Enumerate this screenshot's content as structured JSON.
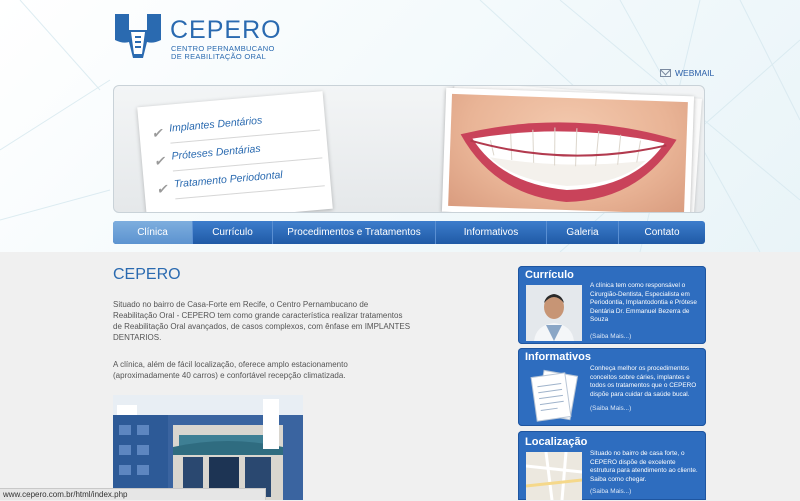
{
  "logo": {
    "name": "CEPERO",
    "subtitle_line1": "CENTRO PERNAMBUCANO",
    "subtitle_line2": "DE REABILITAÇÃO ORAL"
  },
  "header": {
    "webmail_label": "WEBMAIL"
  },
  "banner": {
    "items": [
      "Implantes Dentários",
      "Próteses Dentárias",
      "Tratamento Periodontal"
    ]
  },
  "nav": {
    "items": [
      {
        "label": "Clínica",
        "active": true
      },
      {
        "label": "Currículo"
      },
      {
        "label": "Procedimentos e Tratamentos"
      },
      {
        "label": "Informativos"
      },
      {
        "label": "Galeria"
      },
      {
        "label": "Contato"
      }
    ]
  },
  "main": {
    "title": "CEPERO",
    "paragraph1": "Situado no bairro de Casa-Forte em Recife, o Centro Pernambucano de Reabilitação Oral - CEPERO tem como grande característica realizar tratamentos de Reabilitação Oral avançados, de casos complexos, com ênfase em IMPLANTES DENTARIOS.",
    "paragraph2": "A clínica, além de fácil localização, oferece amplo estacionamento (aproximadamente 40 carros) e confortável recepção climatizada."
  },
  "sidebar": {
    "curriculo": {
      "title": "Currículo",
      "text": "A clínica tem como responsável o Cirurgião-Dentista, Especialista em Periodontia, Implantodontia e Prótese Dentária Dr. Emmanuel Bezerra de Souza",
      "more": "(Saiba Mais...)"
    },
    "informativos": {
      "title": "Informativos",
      "text": "Conheça melhor os procedimentos conceitos sobre cáries, implantes e todos os tratamentos que o CEPERO dispõe para cuidar da saúde bucal.",
      "more": "(Saiba Mais...)"
    },
    "localizacao": {
      "title": "Localização",
      "text": "Situado no bairro de casa forte, o CEPERO dispõe de excelente estrutura para atendimento ao cliente. Saiba como chegar.",
      "more": "(Saiba Mais...)"
    }
  },
  "status_bar": {
    "url": "www.cepero.com.br/html/index.php"
  },
  "colors": {
    "brand_blue": "#2a6ab0",
    "nav_blue": "#2e6dbf",
    "page_bg": "#f0f0f0"
  }
}
